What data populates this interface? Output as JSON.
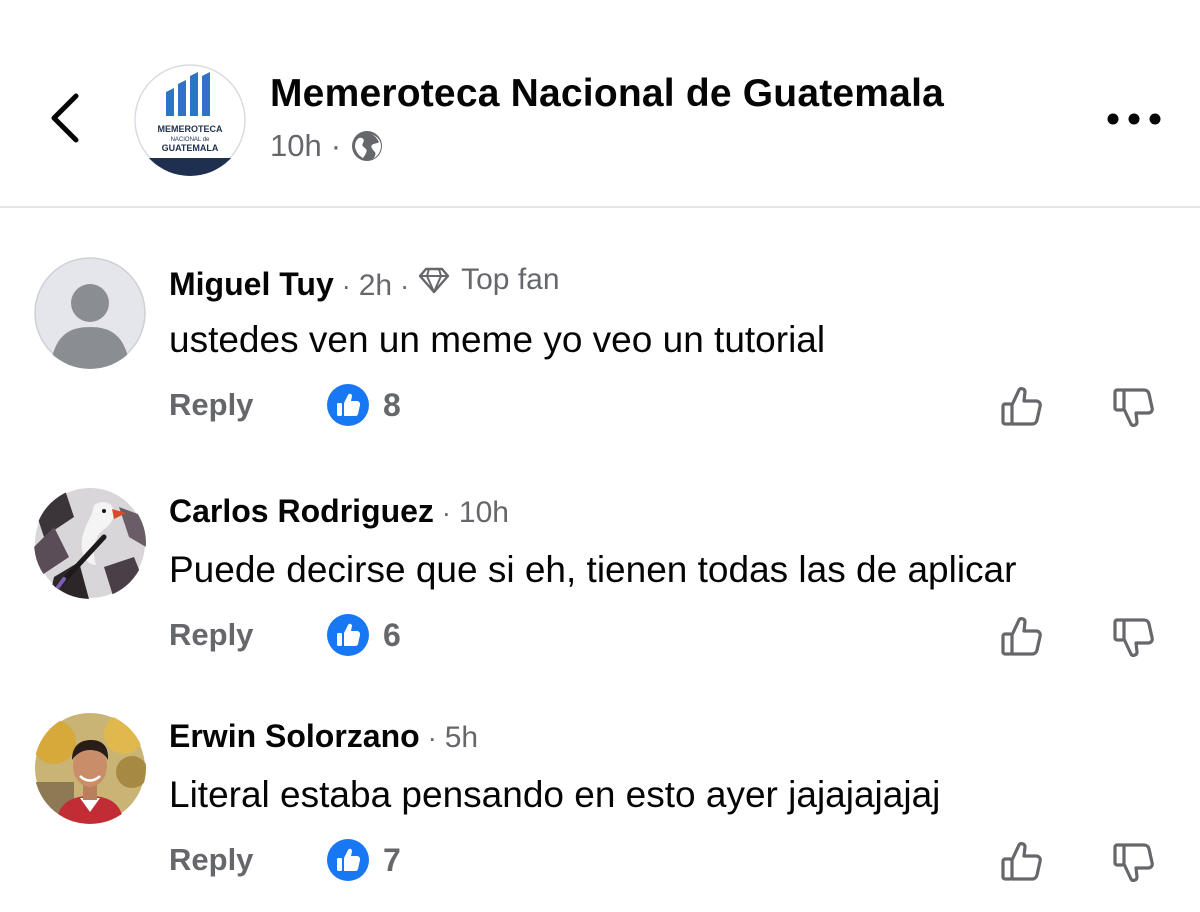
{
  "header": {
    "page_name": "Memeroteca Nacional de Guatemala",
    "time": "10h",
    "separator": "·",
    "privacy_icon": "globe-icon",
    "back_icon": "chevron-left-icon",
    "more_icon": "more-horizontal-icon",
    "logo": {
      "line1": "MEMEROTECA",
      "line2": "NACIONAL de",
      "line3": "GUATEMALA",
      "colors": {
        "blue": "#2f73c9",
        "navy": "#1e2f4f"
      }
    }
  },
  "colors": {
    "like_blue": "#1877f2",
    "secondary_text": "#65676b",
    "primary_text": "#050505"
  },
  "comments": [
    {
      "name": "Miguel Tuy",
      "time": "2h",
      "badge": "Top fan",
      "badge_icon": "diamond-icon",
      "text": "ustedes ven un meme yo veo un tutorial",
      "reply_label": "Reply",
      "like_count": "8",
      "avatar": "default-avatar"
    },
    {
      "name": "Carlos Rodriguez",
      "time": "10h",
      "text": "Puede decirse que si eh, tienen todas las de aplicar",
      "reply_label": "Reply",
      "like_count": "6",
      "avatar": "goose-avatar"
    },
    {
      "name": "Erwin Solorzano",
      "time": "5h",
      "text": "Literal estaba pensando en esto ayer jajajajajaj",
      "reply_label": "Reply",
      "like_count": "7",
      "avatar": "photo-avatar"
    }
  ]
}
